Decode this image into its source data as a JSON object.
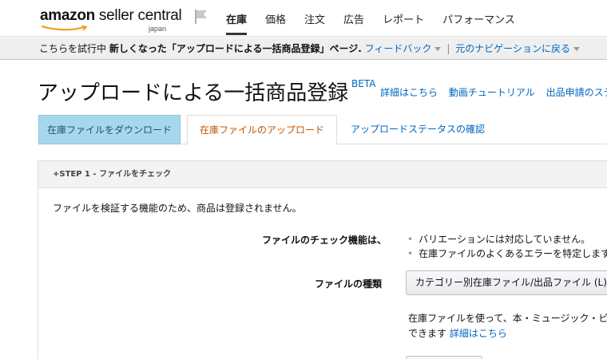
{
  "header": {
    "logo_text_bold": "amazon",
    "logo_text": " seller central",
    "logo_sub": "japan",
    "nav": [
      {
        "label": "在庫",
        "active": true
      },
      {
        "label": "価格",
        "active": false
      },
      {
        "label": "注文",
        "active": false
      },
      {
        "label": "広告",
        "active": false
      },
      {
        "label": "レポート",
        "active": false
      },
      {
        "label": "パフォーマンス",
        "active": false
      }
    ]
  },
  "feedback_bar": {
    "prefix": "こちらを試行中",
    "bold_text": "新しくなった「アップロードによる一括商品登録」ページ.",
    "feedback_link": "フィードバック",
    "separator": "|",
    "back_link": "元のナビゲーションに戻る"
  },
  "page": {
    "title": "アップロードによる一括商品登録",
    "beta": "BETA",
    "links": [
      "詳細はこちら",
      "動画チュートリアル",
      "出品申請のステ"
    ]
  },
  "tabs": [
    {
      "label": "在庫ファイルをダウンロード"
    },
    {
      "label": "在庫ファイルのアップロード"
    },
    {
      "label": "アップロードステータスの確認"
    }
  ],
  "step": {
    "header": "+STEP 1 - ファイルをチェック",
    "note": "ファイルを検証する機能のため、商品は登録されません。",
    "check_label": "ファイルのチェック機能は、",
    "check_bullets": [
      "バリエーションには対応していません。",
      "在庫ファイルのよくあるエラーを特定します。"
    ],
    "type_label": "ファイルの種類",
    "type_select_value": "カテゴリー別在庫ファイル/出品ファイル (L)/価",
    "desc_line1": "在庫ファイルを使って、本・ミュージック・ビデオ",
    "desc_line2": "できます",
    "desc_link": "詳細はこちら"
  },
  "colors": {
    "link": "#0066c0",
    "active_tab": "#c45500",
    "download_tab_bg": "#a7d7ec"
  }
}
